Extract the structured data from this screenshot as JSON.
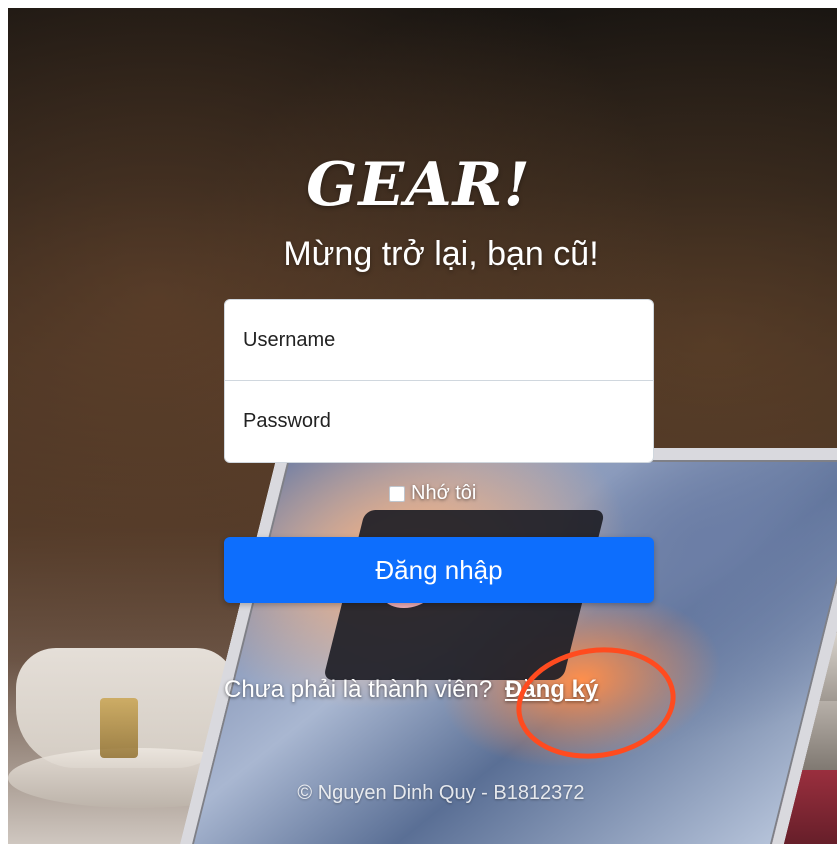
{
  "header": {
    "brand": "GEAR!",
    "welcome": "Mừng trở lại, bạn cũ!"
  },
  "form": {
    "username_placeholder": "Username",
    "password_placeholder": "Password",
    "remember_label": "Nhớ tôi",
    "remember_checked": false,
    "login_button": "Đăng nhập"
  },
  "signup": {
    "prompt": "Chưa phải là thành viên?",
    "link": "Đăng ký"
  },
  "footer": {
    "text": "© Nguyen Dinh Quy - B1812372"
  },
  "colors": {
    "primary_button": "#0d6efd",
    "highlight_annotation": "#ff4b1f"
  },
  "icons": {
    "checkbox": "checkbox-icon"
  }
}
